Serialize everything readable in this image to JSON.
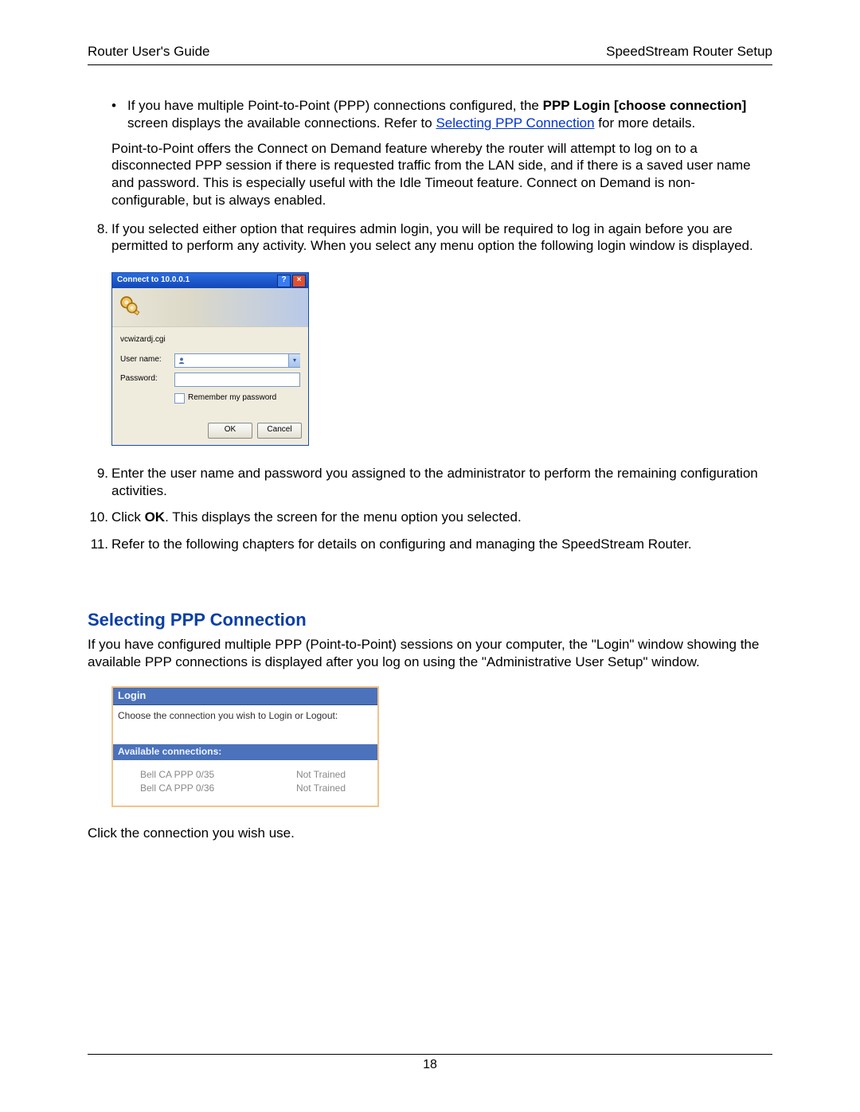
{
  "header": {
    "left": "Router User's Guide",
    "right": "SpeedStream Router Setup"
  },
  "bullet1": {
    "prefix": "If you have multiple Point-to-Point (PPP) connections configured, the ",
    "bold1": "PPP Login [choose connection]",
    "mid": " screen displays the available connections. Refer to ",
    "link": "Selecting PPP Connection",
    "suffix": " for more details."
  },
  "para_cod": "Point-to-Point offers the Connect on Demand feature whereby the router will attempt to log on to a disconnected PPP session if there is requested traffic from the LAN side, and if there is a saved user name and password. This is especially useful with the Idle Timeout  feature. Connect on Demand is non-configurable, but is always enabled.",
  "step8": {
    "num": "8.",
    "text": "If you selected either option that requires admin login, you will be required to log in again before you are permitted to perform any activity. When you select any menu option the following login window is displayed."
  },
  "login_dialog": {
    "title": "Connect to 10.0.0.1",
    "realm": "vcwizardj.cgi",
    "username_label": "User name:",
    "password_label": "Password:",
    "remember_label": "Remember my password",
    "ok": "OK",
    "cancel": "Cancel"
  },
  "step9": {
    "num": "9.",
    "text": "Enter the user name and password you assigned to the administrator to perform the remaining configuration activities."
  },
  "step10": {
    "num": "10.",
    "pre": "Click ",
    "bold": "OK",
    "post": ". This displays the screen for the menu option you selected."
  },
  "step11": {
    "num": "11.",
    "text": "Refer to the following chapters for details on configuring and managing the SpeedStream Router."
  },
  "section_title": "Selecting PPP Connection",
  "section_para": "If you have configured multiple PPP (Point-to-Point) sessions on your computer, the \"Login\" window showing the available PPP connections is displayed after you log on using the \"Administrative User Setup\" window.",
  "login_panel": {
    "header": "Login",
    "instr": "Choose the connection you wish to Login or Logout:",
    "subheader": "Available connections:",
    "rows": [
      {
        "name": "Bell CA PPP 0/35",
        "status": "Not Trained"
      },
      {
        "name": "Bell CA PPP 0/36",
        "status": "Not Trained"
      }
    ]
  },
  "after_panel": "Click the connection you wish use.",
  "page_number": "18"
}
